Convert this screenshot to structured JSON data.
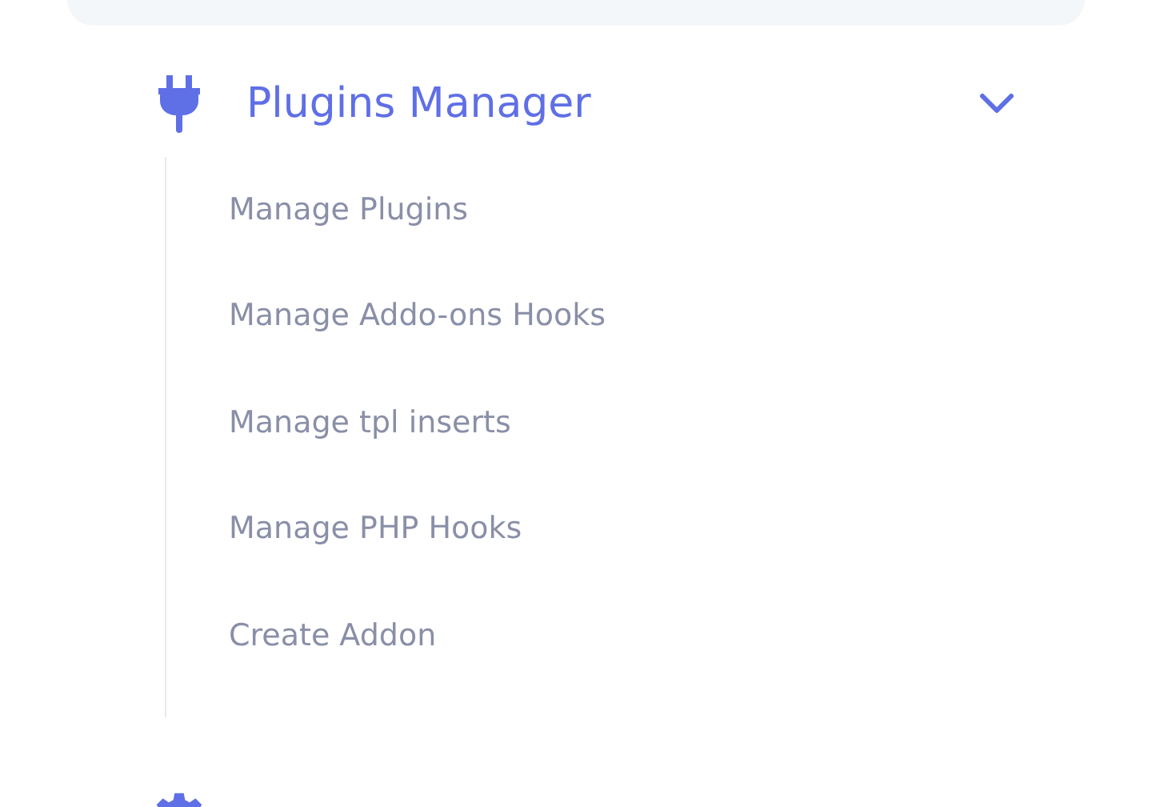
{
  "menu": {
    "title": "Plugins Manager",
    "expanded": true,
    "items": [
      {
        "label": "Manage Plugins"
      },
      {
        "label": "Manage Addo-ons Hooks"
      },
      {
        "label": "Manage tpl inserts"
      },
      {
        "label": "Manage PHP Hooks"
      },
      {
        "label": "Create Addon"
      }
    ]
  }
}
